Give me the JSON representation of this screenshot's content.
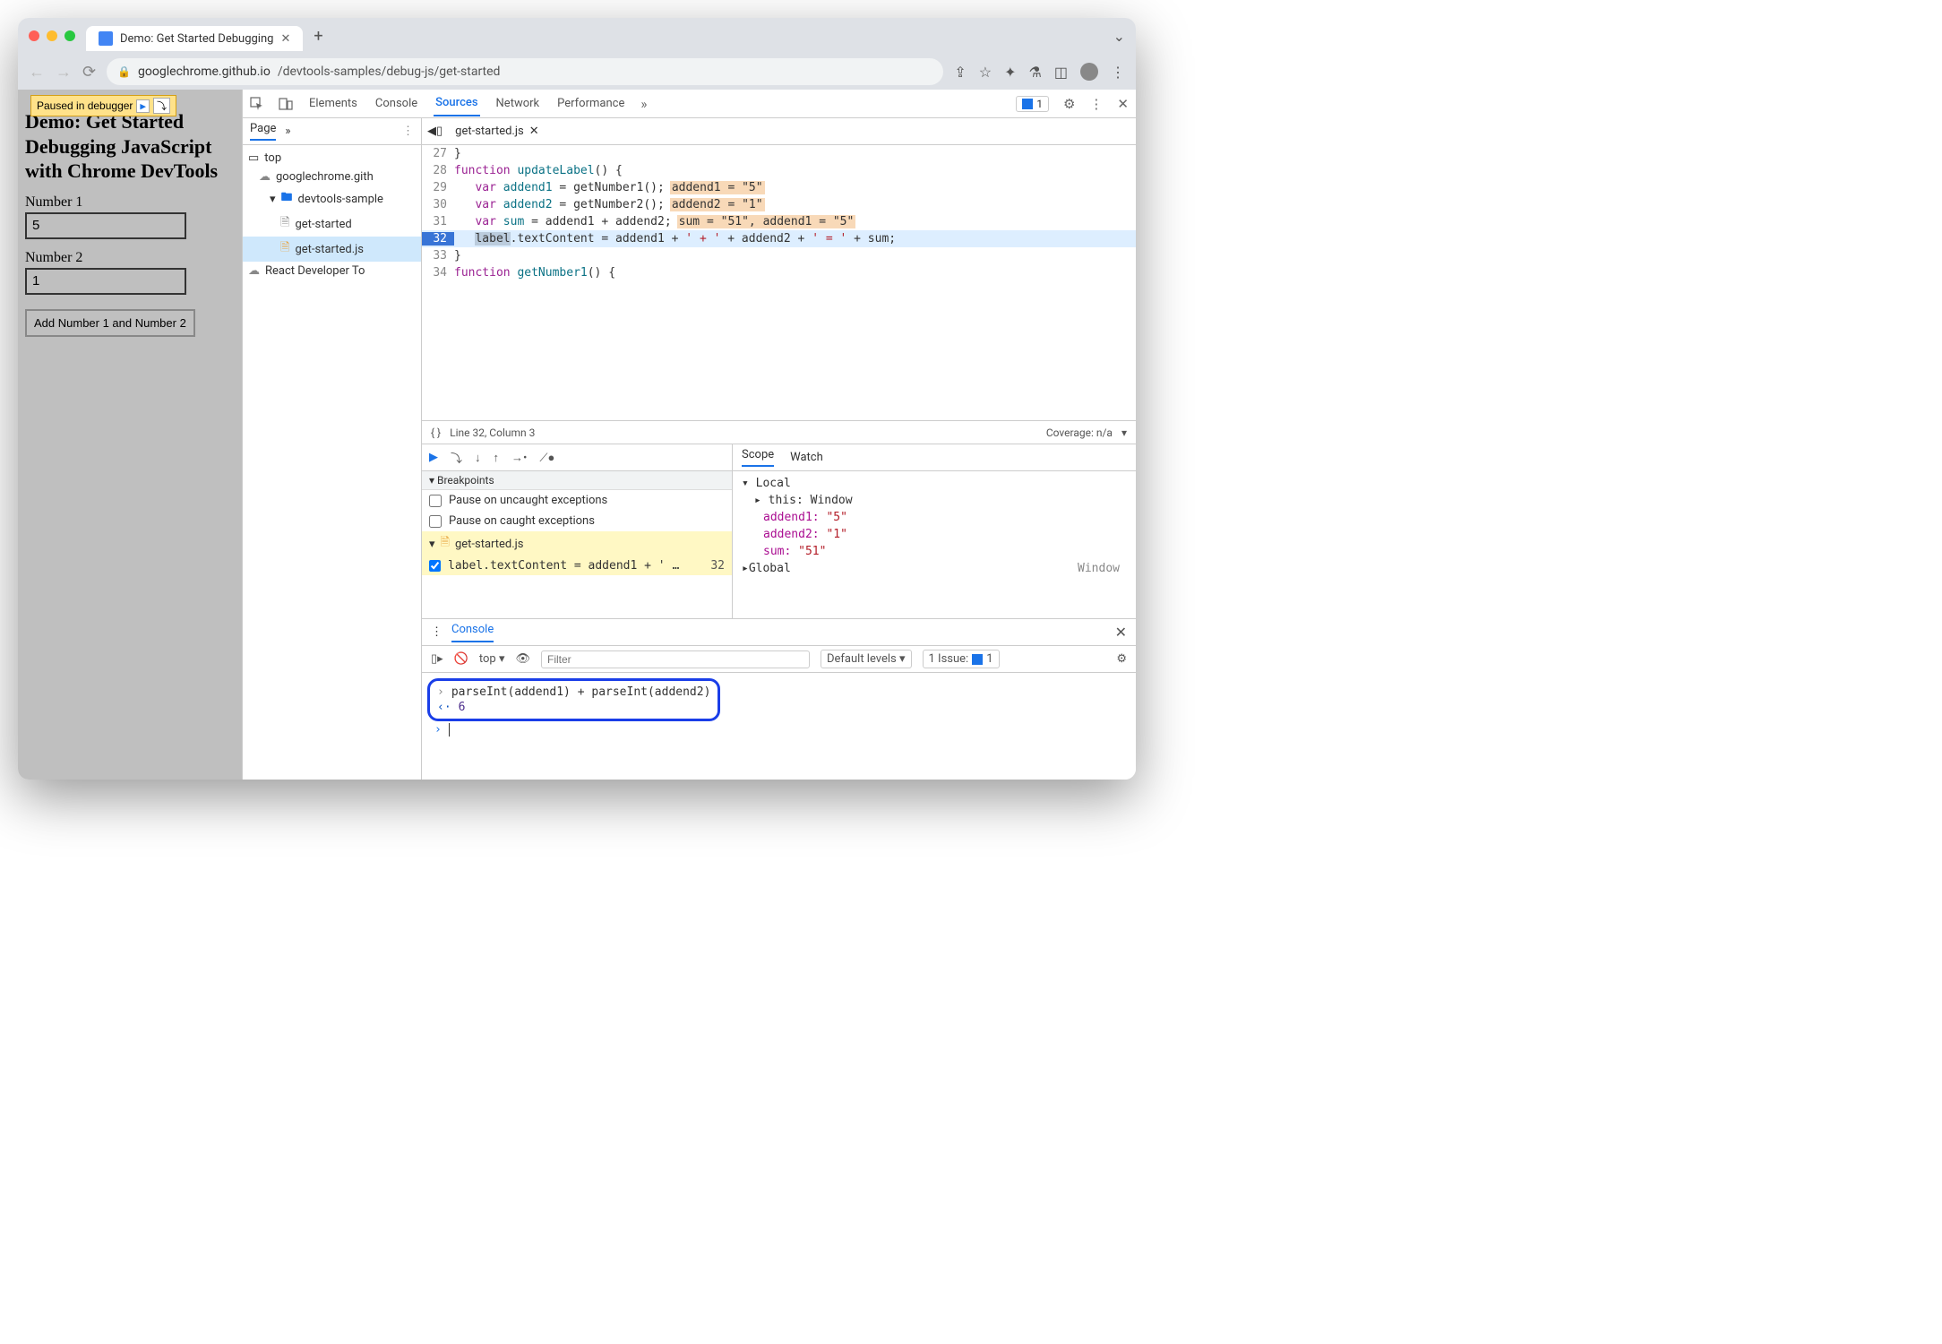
{
  "browser": {
    "tab_title": "Demo: Get Started Debugging",
    "url_host": "googlechrome.github.io",
    "url_path": "/devtools-samples/debug-js/get-started"
  },
  "page": {
    "paused_text": "Paused in debugger",
    "heading": "Demo: Get Started Debugging JavaScript with Chrome DevTools",
    "label1": "Number 1",
    "value1": "5",
    "label2": "Number 2",
    "value2": "1",
    "button": "Add Number 1 and Number 2"
  },
  "devtools": {
    "tabs": {
      "elements": "Elements",
      "console": "Console",
      "sources": "Sources",
      "network": "Network",
      "performance": "Performance"
    },
    "issues_count": "1",
    "nav": {
      "page": "Page",
      "tree": {
        "top": "top",
        "domain": "googlechrome.gith",
        "folder": "devtools-sample",
        "file_html": "get-started",
        "file_js": "get-started.js",
        "react": "React Developer To"
      }
    },
    "file_tab": "get-started.js",
    "code": {
      "l27": {
        "n": "27",
        "t": "}"
      },
      "l28": {
        "n": "28",
        "kw": "function ",
        "fn": "updateLabel",
        "rest": "() {"
      },
      "l29": {
        "n": "29",
        "pre": "   ",
        "kw": "var ",
        "v": "addend1",
        "rest": " = getNumber1();",
        "hint": "addend1 = \"5\""
      },
      "l30": {
        "n": "30",
        "pre": "   ",
        "kw": "var ",
        "v": "addend2",
        "rest": " = getNumber2();",
        "hint": "addend2 = \"1\""
      },
      "l31": {
        "n": "31",
        "pre": "   ",
        "kw": "var ",
        "v": "sum",
        "rest": " = addend1 + addend2;",
        "hint": "sum = \"51\", addend1 = \"5\""
      },
      "l32": {
        "n": "32",
        "pre": "   ",
        "sel": "label",
        "rest1": ".textContent = addend1 + ",
        "s1": "' + '",
        "rest2": " + addend2 + ",
        "s2": "' = '",
        "rest3": " + sum;"
      },
      "l33": {
        "n": "33",
        "t": "}"
      },
      "l34": {
        "n": "34",
        "kw": "function ",
        "fn": "getNumber1",
        "rest": "() {"
      }
    },
    "status": {
      "pos": "Line 32, Column 3",
      "coverage": "Coverage: n/a"
    },
    "breakpoints": {
      "header": "Breakpoints",
      "uncaught": "Pause on uncaught exceptions",
      "caught": "Pause on caught exceptions",
      "file": "get-started.js",
      "line_text": "label.textContent = addend1 + ' …",
      "line_num": "32"
    },
    "scope": {
      "tab_scope": "Scope",
      "tab_watch": "Watch",
      "local": "Local",
      "this_label": "this: ",
      "this_val": "Window",
      "a1": "addend1: ",
      "a1v": "\"5\"",
      "a2": "addend2: ",
      "a2v": "\"1\"",
      "sum": "sum: ",
      "sumv": "\"51\"",
      "global": "Global",
      "window": "Window"
    }
  },
  "console": {
    "tab": "Console",
    "context": "top",
    "filter_placeholder": "Filter",
    "levels": "Default levels",
    "issue_label": "1 Issue:",
    "issue_count": "1",
    "input": "parseInt(addend1) + parseInt(addend2)",
    "output": "6"
  }
}
